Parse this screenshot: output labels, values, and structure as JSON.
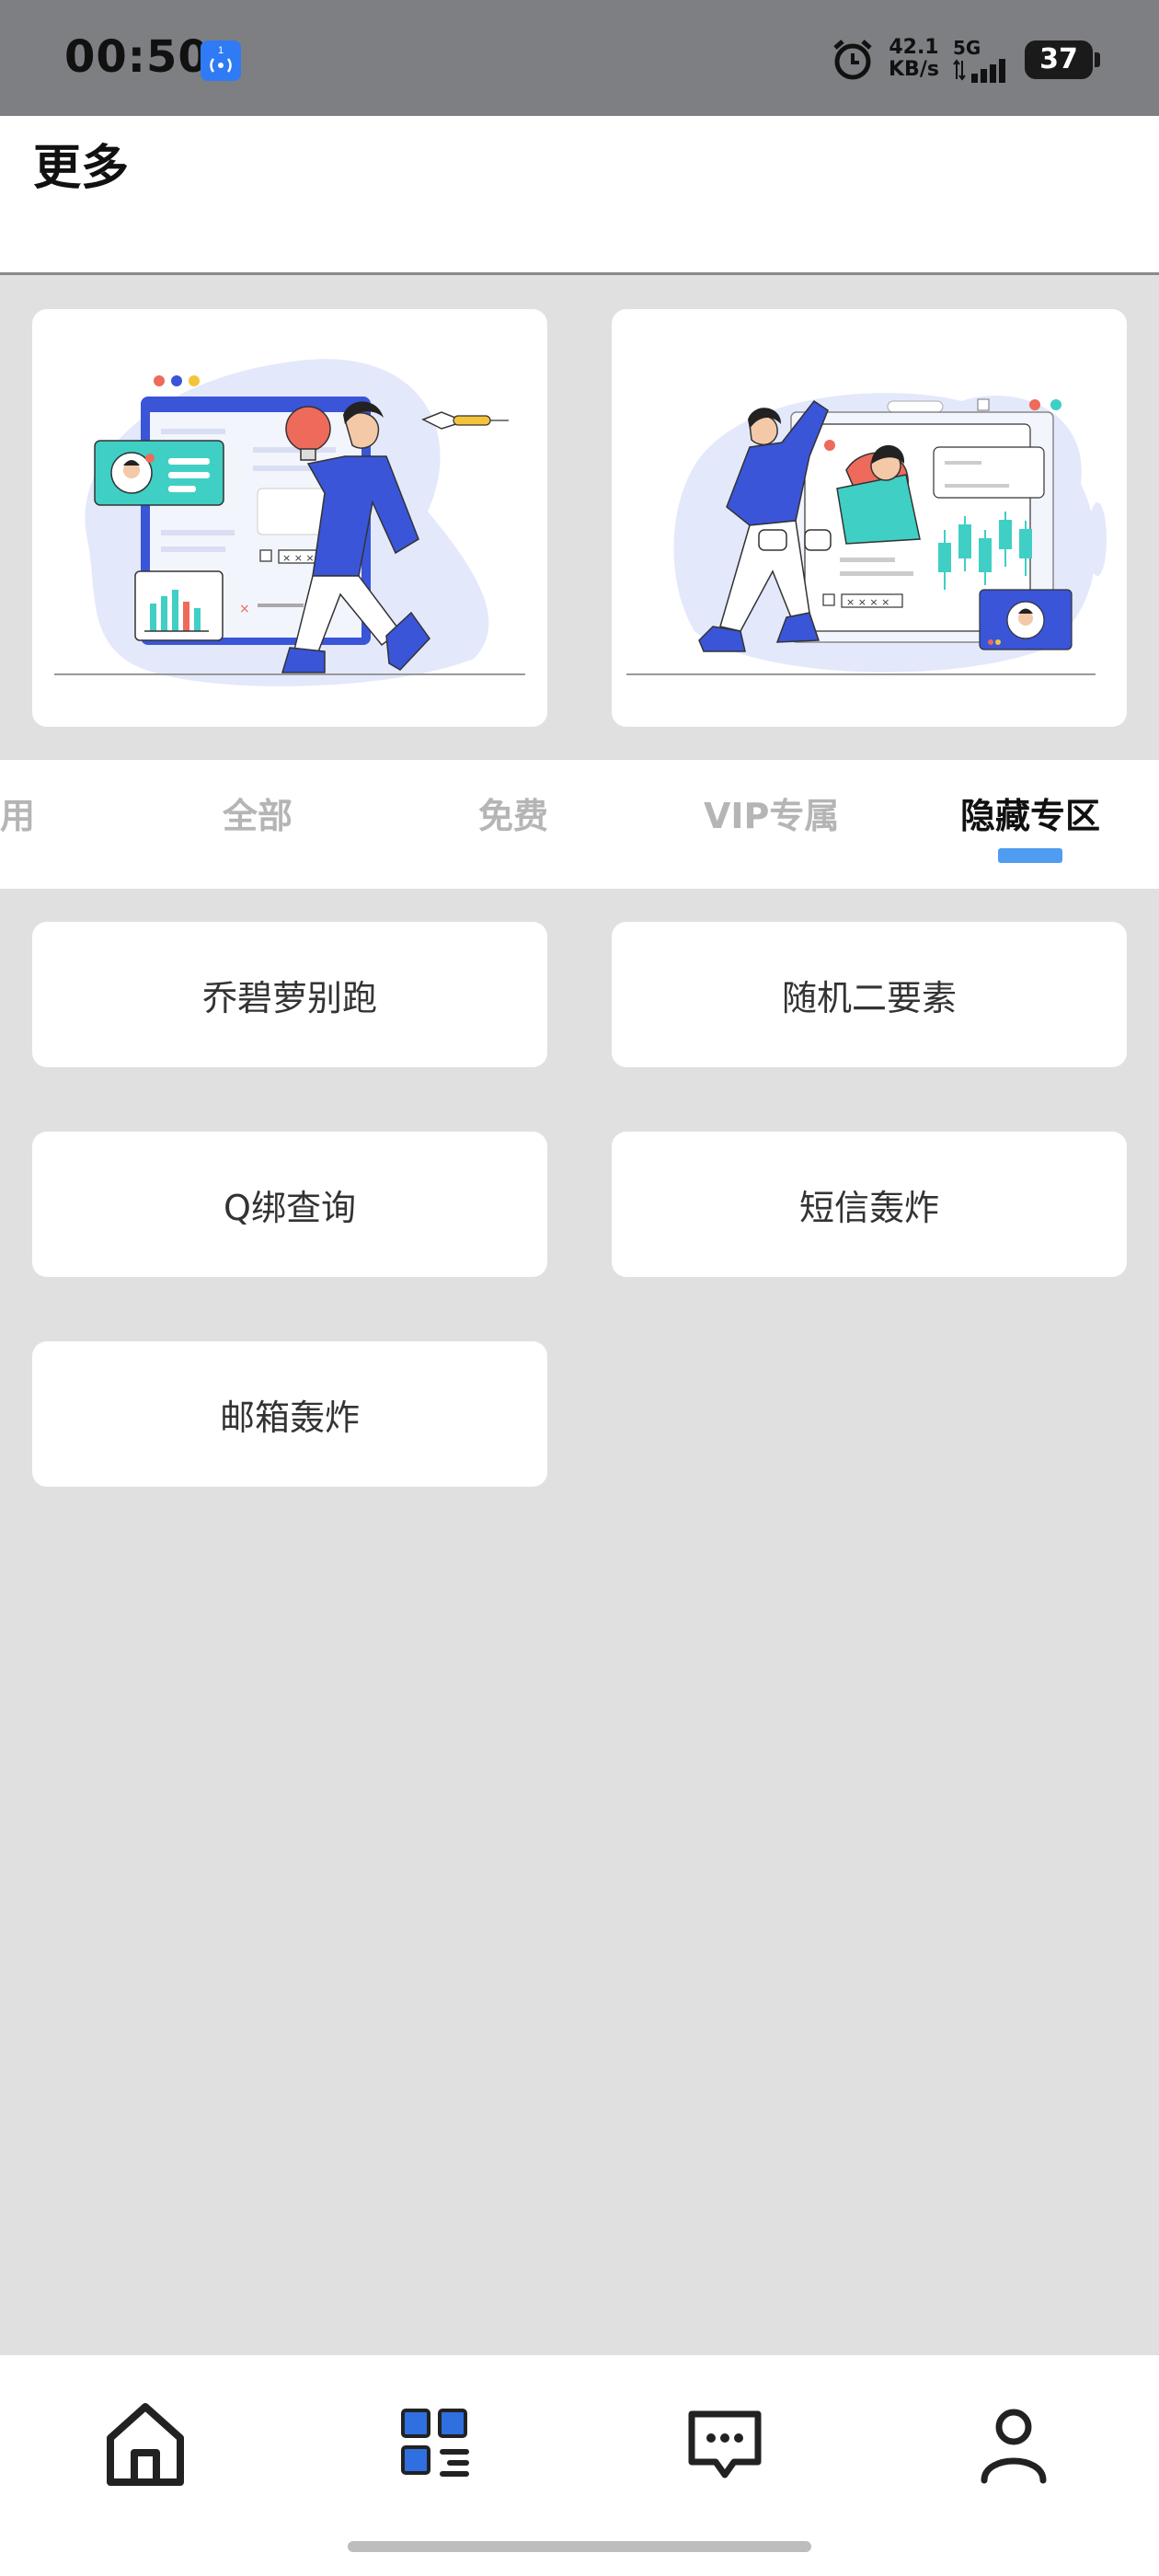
{
  "status_bar": {
    "time": "00:50",
    "hotspot_icon": "hotspot-icon",
    "hotspot_count": "1",
    "alarm_icon": "alarm-icon",
    "speed_value": "42.1",
    "speed_unit": "KB/s",
    "network": "5G",
    "battery": "37"
  },
  "header": {
    "title": "更多"
  },
  "banners": [
    {
      "icon": "illustration-idea-person"
    },
    {
      "icon": "illustration-two-people-chart"
    }
  ],
  "tabs": {
    "items": [
      {
        "label": "用"
      },
      {
        "label": "全部"
      },
      {
        "label": "免费"
      },
      {
        "label": "VIP专属"
      },
      {
        "label": "隐藏专区"
      }
    ],
    "active": "隐藏专区",
    "accent_color": "#4f9cf0"
  },
  "tools": [
    {
      "label": "乔碧萝别跑"
    },
    {
      "label": "随机二要素"
    },
    {
      "label": "Q绑查询"
    },
    {
      "label": "短信轰炸"
    },
    {
      "label": "邮箱轰炸"
    }
  ],
  "bottom_nav": {
    "items": [
      {
        "icon": "home-icon"
      },
      {
        "icon": "apps-grid-icon"
      },
      {
        "icon": "message-icon"
      },
      {
        "icon": "user-icon"
      }
    ],
    "active_color": "#2f6fe0"
  }
}
